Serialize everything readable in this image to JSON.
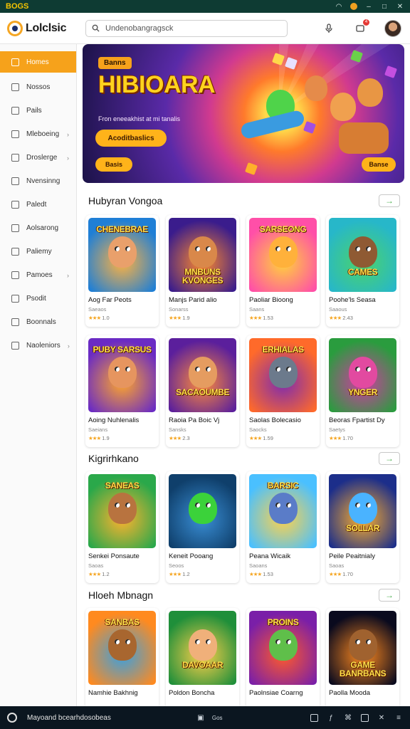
{
  "os": {
    "brand": "BOGS",
    "icons": [
      "wifi-icon",
      "coin-icon",
      "minimize-icon",
      "maximize-icon",
      "close-icon"
    ]
  },
  "header": {
    "logo_text": "Lolclsic",
    "search_placeholder": "Undenobangragsck",
    "icons": [
      "mic-icon",
      "notification-icon",
      "avatar"
    ],
    "notification_count": "4"
  },
  "sidebar": {
    "items": [
      {
        "label": "Homes",
        "active": true,
        "chevron": false
      },
      {
        "label": "Nossos",
        "active": false,
        "chevron": false
      },
      {
        "label": "Pails",
        "active": false,
        "chevron": false
      },
      {
        "label": "Mleboeing",
        "active": false,
        "chevron": true
      },
      {
        "label": "Droslerge",
        "active": false,
        "chevron": true
      },
      {
        "label": "Nvensinng",
        "active": false,
        "chevron": false
      },
      {
        "label": "Paledt",
        "active": false,
        "chevron": false
      },
      {
        "label": "Aolsarong",
        "active": false,
        "chevron": false
      },
      {
        "label": "Paliemy",
        "active": false,
        "chevron": false
      },
      {
        "label": "Pamoes",
        "active": false,
        "chevron": true
      },
      {
        "label": "Psodit",
        "active": false,
        "chevron": false
      },
      {
        "label": "Boonnals",
        "active": false,
        "chevron": false
      },
      {
        "label": "Naoleniors",
        "active": false,
        "chevron": true
      }
    ]
  },
  "hero": {
    "tag": "Banns",
    "title": "HIBIOARA",
    "subtitle": "Fron eneeakhist at mi tanalis",
    "cta": "Acoditbaslics",
    "button_left": "Basis",
    "button_right": "Banse"
  },
  "sections": [
    {
      "title": "Hubyran Vongoa",
      "cards": [
        {
          "thumb_text": "CHENEBRAE",
          "name": "Aog Far Peots",
          "meta": "Saeaos",
          "stars": "★★★",
          "score": "1.0",
          "bg": [
            "#1f7fd6",
            "#ffb240"
          ],
          "face": "#e9a06b"
        },
        {
          "thumb_text": "MNBUNS KVONGES",
          "name": "Manjs Parid alio",
          "meta": "Sonarss",
          "stars": "★★★",
          "score": "1.9",
          "bg": [
            "#3a1c8c",
            "#ff8a2b"
          ],
          "face": "#d9884a"
        },
        {
          "thumb_text": "SARSEONG",
          "name": "Paoliar Bioong",
          "meta": "Saans",
          "stars": "★★★",
          "score": "1.53",
          "bg": [
            "#ff4fa8",
            "#ffd33a"
          ],
          "face": "#ffb13b"
        },
        {
          "thumb_text": "CAMES",
          "name": "Poohe'ls Seasa",
          "meta": "Saaous",
          "stars": "★★★",
          "score": "2.43",
          "bg": [
            "#27b7c9",
            "#4bd36a"
          ],
          "face": "#8f5a33"
        }
      ]
    },
    {
      "title": "",
      "cards": [
        {
          "thumb_text": "PUBY SARSUS",
          "name": "Aoing Nuhlenalis",
          "meta": "Saeians",
          "stars": "★★★",
          "score": "1.9",
          "bg": [
            "#6a2bc4",
            "#ffa72a"
          ],
          "face": "#e6955f"
        },
        {
          "thumb_text": "SACAOUMBE",
          "name": "Raoia Pa Boic Vj",
          "meta": "Sansks",
          "stars": "★★★",
          "score": "2.3",
          "bg": [
            "#5b1f9c",
            "#ff8c3a"
          ],
          "face": "#e59c60"
        },
        {
          "thumb_text": "ERHIALAS",
          "name": "Saolas Bolecasio",
          "meta": "Saocks",
          "stars": "★★★",
          "score": "1.59",
          "bg": [
            "#ff6a2a",
            "#7d2bb0"
          ],
          "face": "#6c7a8c"
        },
        {
          "thumb_text": "YNGER",
          "name": "Beoras Fpartist Dy",
          "meta": "Saetys",
          "stars": "★★★",
          "score": "1.70",
          "bg": [
            "#2a9c3e",
            "#d13aa3"
          ],
          "face": "#e24aa0"
        }
      ]
    },
    {
      "title": "Kigrirhkano",
      "cards": [
        {
          "thumb_text": "SANEAS",
          "name": "Senkei Ponsaute",
          "meta": "Saoas",
          "stars": "★★★",
          "score": "1.2",
          "bg": [
            "#2aa84a",
            "#ffb22e"
          ],
          "face": "#b8733f"
        },
        {
          "thumb_text": "",
          "name": "Keneit Pooang",
          "meta": "Seoos",
          "stars": "★★★",
          "score": "1.2",
          "bg": [
            "#0f3f6b",
            "#3a8fd6"
          ],
          "face": "#3bd23a"
        },
        {
          "thumb_text": "BARSIC",
          "name": "Peana Wicaik",
          "meta": "Saoans",
          "stars": "★★★",
          "score": "1.53",
          "bg": [
            "#4ac0ff",
            "#ffd24a"
          ],
          "face": "#5a7cc8"
        },
        {
          "thumb_text": "SOLLAR",
          "name": "Peile Peaitnialy",
          "meta": "Saoas",
          "stars": "★★★",
          "score": "1.70",
          "bg": [
            "#1c2e8a",
            "#ffb02a"
          ],
          "face": "#4ab3ff"
        }
      ]
    },
    {
      "title": "Hloeh Mbnagn",
      "cards": [
        {
          "thumb_text": "SANBAS",
          "name": "Namhie Bakhnig",
          "meta": "",
          "stars": "",
          "score": "",
          "bg": [
            "#ff8a1f",
            "#3aa0e0"
          ],
          "face": "#a8662f"
        },
        {
          "thumb_text": "DAVOAAR",
          "name": "Poldon Boncha",
          "meta": "",
          "stars": "",
          "score": "",
          "bg": [
            "#1f8f3a",
            "#ffd04a"
          ],
          "face": "#f0b07a"
        },
        {
          "thumb_text": "PROINS",
          "name": "Paolnsiae Coarng",
          "meta": "",
          "stars": "",
          "score": "",
          "bg": [
            "#7a1fa8",
            "#ff5a2a"
          ],
          "face": "#5fbf4a"
        },
        {
          "thumb_text": "GAME BANRBANS",
          "name": "Paolla Mooda",
          "meta": "",
          "stars": "",
          "score": "",
          "bg": [
            "#0a0a1e",
            "#ff8a1f"
          ],
          "face": "#a0622f"
        }
      ]
    }
  ],
  "taskbar": {
    "text": "Mayoand bcearhdosobeas",
    "label": "Gos",
    "icons": [
      "start-icon",
      "taskbar-app-icon",
      "calendar-icon",
      "feather-icon",
      "link-icon",
      "chat-icon",
      "close-icon"
    ]
  },
  "colors": {
    "accent": "#f6a21b",
    "os_bar": "#0e3b33",
    "taskbar": "#0b1620",
    "star": "#f5a623",
    "arrow": "#4caf50"
  }
}
